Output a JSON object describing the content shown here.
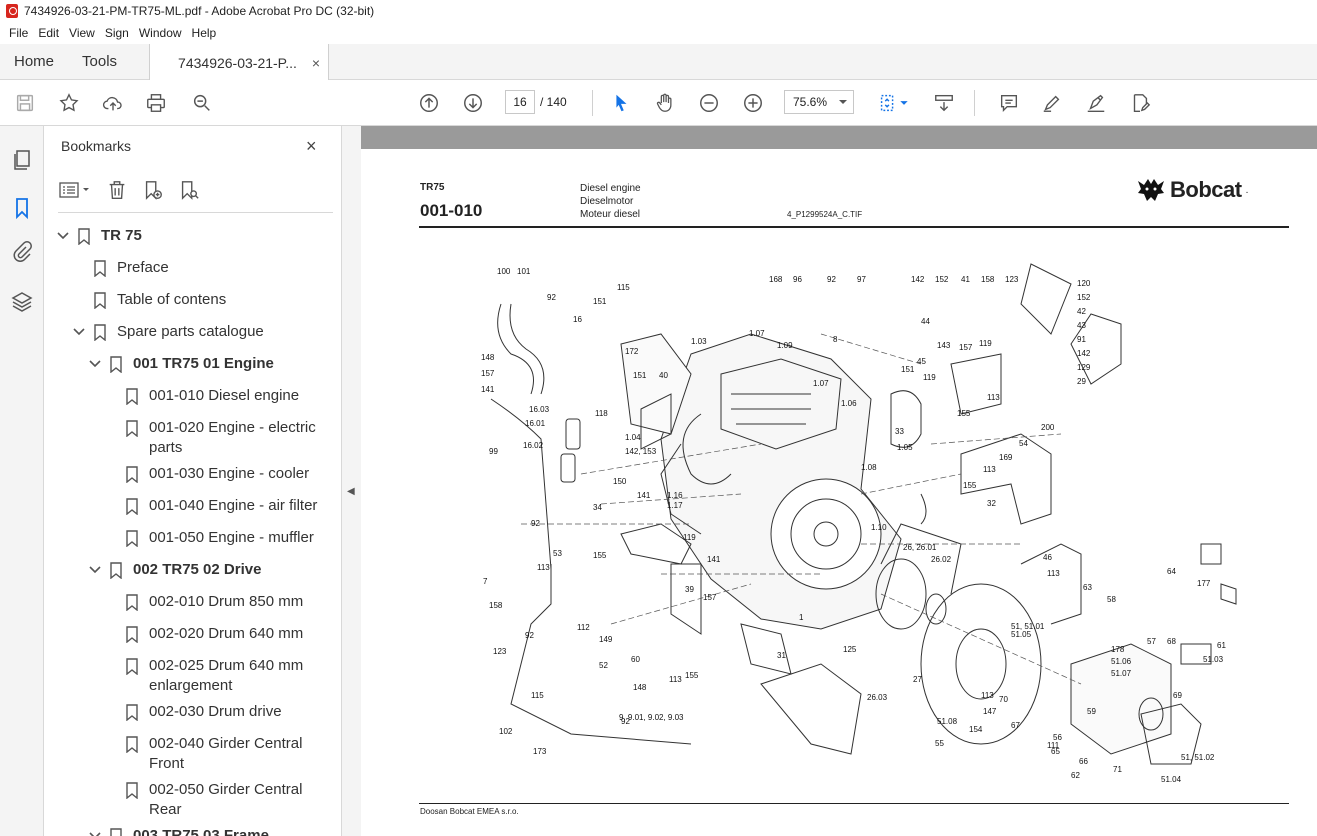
{
  "window": {
    "title": "7434926-03-21-PM-TR75-ML.pdf - Adobe Acrobat Pro DC (32-bit)"
  },
  "menu": [
    "File",
    "Edit",
    "View",
    "Sign",
    "Window",
    "Help"
  ],
  "tabs": {
    "home": "Home",
    "tools": "Tools",
    "document": "7434926-03-21-P...",
    "close": "×"
  },
  "toolbar": {
    "page_current": "16",
    "page_total": "/ 140",
    "zoom": "75.6%"
  },
  "bookmarks": {
    "title": "Bookmarks",
    "close": "×",
    "items": [
      {
        "label": "TR 75",
        "level": 0,
        "bold": true,
        "expanded": true
      },
      {
        "label": "Preface",
        "level": 1
      },
      {
        "label": "Table of contens",
        "level": 1
      },
      {
        "label": "Spare parts catalogue",
        "level": 1,
        "expanded": true
      },
      {
        "label": "001 TR75 01 Engine",
        "level": 2,
        "bold": true,
        "expanded": true
      },
      {
        "label": "001-010 Diesel engine",
        "level": 3,
        "selected": true
      },
      {
        "label": "001-020 Engine - electric",
        "label2": "parts",
        "level": 3
      },
      {
        "label": "001-030 Engine - cooler",
        "level": 3
      },
      {
        "label": "001-040 Engine - air filter",
        "level": 3
      },
      {
        "label": "001-050 Engine - muffler",
        "level": 3
      },
      {
        "label": "002 TR75 02 Drive",
        "level": 2,
        "bold": true,
        "expanded": true
      },
      {
        "label": "002-010 Drum 850 mm",
        "level": 3
      },
      {
        "label": "002-020 Drum 640 mm",
        "level": 3
      },
      {
        "label": "002-025 Drum 640 mm",
        "label2": "enlargement",
        "level": 3
      },
      {
        "label": "002-030 Drum drive",
        "level": 3
      },
      {
        "label": "002-040 Girder Central",
        "label2": "Front",
        "level": 3
      },
      {
        "label": "002-050 Girder Central",
        "label2": "Rear",
        "level": 3
      },
      {
        "label": "003 TR75 03 Frame",
        "level": 2,
        "bold": true,
        "expanded": true
      }
    ]
  },
  "page": {
    "model": "TR75",
    "code": "001-010",
    "desc1": "Diesel engine",
    "desc2": "Dieselmotor",
    "desc3": "Moteur diesel",
    "file": "4_P1299524A_C.TIF",
    "brand": "Bobcat",
    "brand_mark": ".",
    "footer": "Doosan Bobcat EMEA s.r.o.",
    "part_labels": [
      "100",
      "101",
      "92",
      "16",
      "151",
      "115",
      "168",
      "96",
      "92",
      "97",
      "142",
      "152",
      "41",
      "158",
      "123",
      "120",
      "152",
      "42",
      "43",
      "91",
      "142",
      "129",
      "29",
      "148",
      "157",
      "141",
      "1.03",
      "1.07",
      "1.09",
      "172",
      "151",
      "40",
      "8",
      "44",
      "143",
      "45",
      "151",
      "119",
      "157",
      "119",
      "113",
      "155",
      "16.03",
      "16.01",
      "16.02",
      "118",
      "1.04",
      "142, 153",
      "1.07",
      "1.06",
      "33",
      "54",
      "200",
      "169",
      "99",
      "150",
      "141",
      "1.16",
      "1.17",
      "1.05",
      "1.08",
      "113",
      "155",
      "32",
      "92",
      "34",
      "119",
      "155",
      "53",
      "141",
      "1.10",
      "26, 26.01",
      "26.02",
      "46",
      "113",
      "7",
      "113",
      "39",
      "157",
      "158",
      "112",
      "149",
      "52",
      "60",
      "148",
      "123",
      "92",
      "115",
      "9, 9.01, 9.02, 9.03",
      "102",
      "92",
      "173",
      "113",
      "155",
      "31",
      "125",
      "26.03",
      "1",
      "27",
      "63",
      "58",
      "64",
      "177",
      "51, 51.01",
      "51.05",
      "57",
      "68",
      "61",
      "178",
      "51.06",
      "51.07",
      "51.03",
      "69",
      "70",
      "51.08",
      "113",
      "147",
      "154",
      "55",
      "67",
      "111",
      "56",
      "65",
      "59",
      "66",
      "62",
      "71",
      "51, 51.02",
      "51.04"
    ]
  }
}
